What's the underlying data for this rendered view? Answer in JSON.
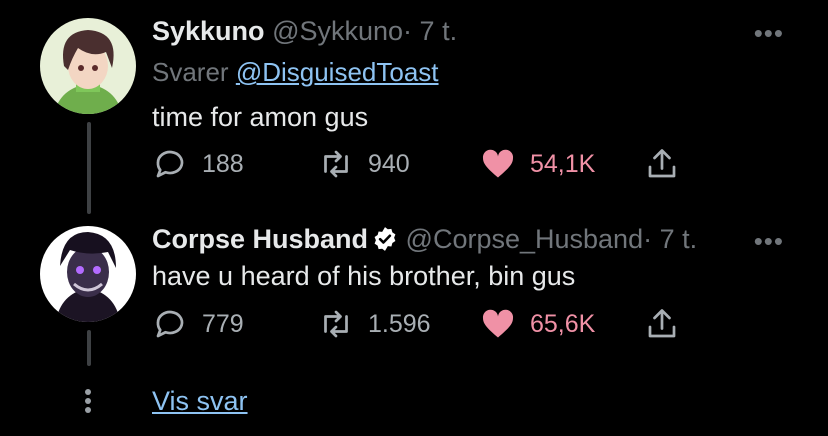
{
  "tweets": [
    {
      "display_name": "Sykkuno",
      "handle": "@Sykkuno",
      "separator": "·",
      "time": "7 t.",
      "reply_prefix": "Svarer",
      "reply_to": "@DisguisedToast",
      "text": "time for amon gus",
      "replies": "188",
      "retweets": "940",
      "likes": "54,1K",
      "liked": true
    },
    {
      "display_name": "Corpse Husband",
      "verified": true,
      "handle": "@Corpse_Husband",
      "separator": "·",
      "time": "7 t.",
      "text": "have u heard of his brother, bin gus",
      "replies": "779",
      "retweets": "1.596",
      "likes": "65,6K",
      "liked": true
    }
  ],
  "show_replies_label": "Vis svar",
  "more_glyph": "•••",
  "colors": {
    "background": "#000000",
    "link": "#8ec3f2",
    "like": "#f091a6",
    "muted": "#71767b"
  },
  "icons": [
    "reply-icon",
    "retweet-icon",
    "heart-icon",
    "share-icon",
    "more-icon",
    "verified-icon"
  ]
}
